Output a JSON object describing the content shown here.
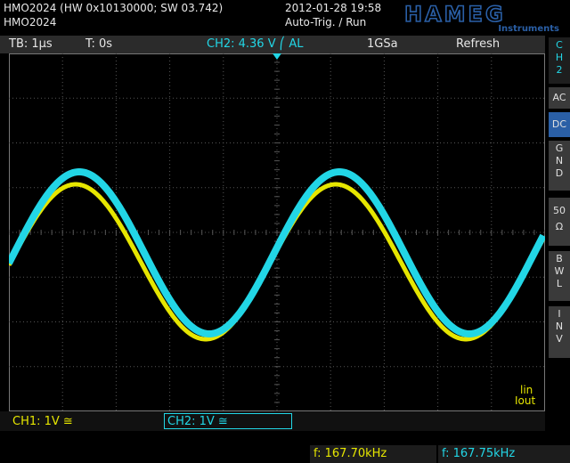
{
  "header": {
    "model_line": "HMO2024 (HW 0x10130000; SW 03.742)",
    "model_short": "HMO2024",
    "datetime": "2012-01-28 19:58",
    "trigger_mode": "Auto-Trig. / Run",
    "brand": "HAMEG",
    "brand_sub": "Instruments"
  },
  "status": {
    "timebase": "TB: 1µs",
    "trigger_time": "T: 0s",
    "trigger_info": "CH2: 4.36 V ⎛ AL",
    "sample_rate": "1GSa",
    "acq_mode": "Refresh"
  },
  "side_menu": {
    "channel": [
      "C",
      "H",
      "2"
    ],
    "coupling_ac": "AC",
    "coupling_dc": "DC",
    "gnd": [
      "G",
      "N",
      "D"
    ],
    "imp50": [
      "50",
      "Ω"
    ],
    "bwl": [
      "B",
      "W",
      "L"
    ],
    "inv": [
      "I",
      "N",
      "V"
    ]
  },
  "bottom": {
    "ch1": "CH1: 1V ≅",
    "ch2": "CH2: 1V ≅",
    "lin_label": "lin",
    "iout_label": "Iout"
  },
  "readouts": {
    "freq_ch1": "f: 167.70kHz",
    "freq_ch2": "f: 167.75kHz"
  },
  "markers": {
    "ch_marker": "2"
  },
  "colors": {
    "ch1": "#e6e600",
    "ch2": "#22d6e6",
    "grid": "#555555",
    "active_menu": "#2a5fa6"
  }
}
